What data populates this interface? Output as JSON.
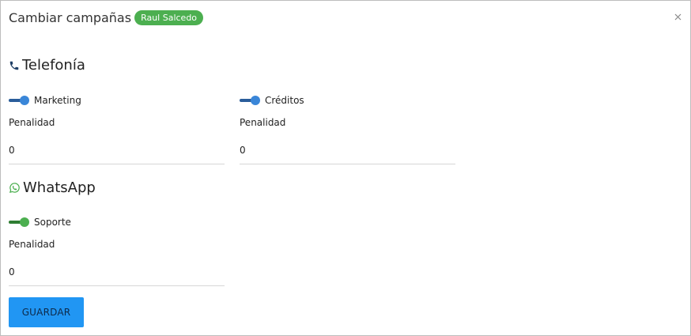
{
  "dialog": {
    "title": "Cambiar campañas",
    "user_badge": "Raul Salcedo",
    "close_icon": "close-icon"
  },
  "sections": {
    "telefonia": {
      "title": "Telefonía",
      "icon": "phone-icon",
      "campaigns": [
        {
          "name": "Marketing",
          "enabled": true,
          "penalty_label": "Penalidad",
          "penalty_value": "0"
        },
        {
          "name": "Créditos",
          "enabled": true,
          "penalty_label": "Penalidad",
          "penalty_value": "0"
        }
      ]
    },
    "whatsapp": {
      "title": "WhatsApp",
      "icon": "whatsapp-icon",
      "campaigns": [
        {
          "name": "Soporte",
          "enabled": true,
          "penalty_label": "Penalidad",
          "penalty_value": "0"
        }
      ]
    }
  },
  "actions": {
    "save_label": "GUARDAR"
  },
  "colors": {
    "badge": "#4caf50",
    "toggle_blue": "#3a86d8",
    "toggle_green": "#4caf50",
    "save_button": "#2196f3"
  }
}
